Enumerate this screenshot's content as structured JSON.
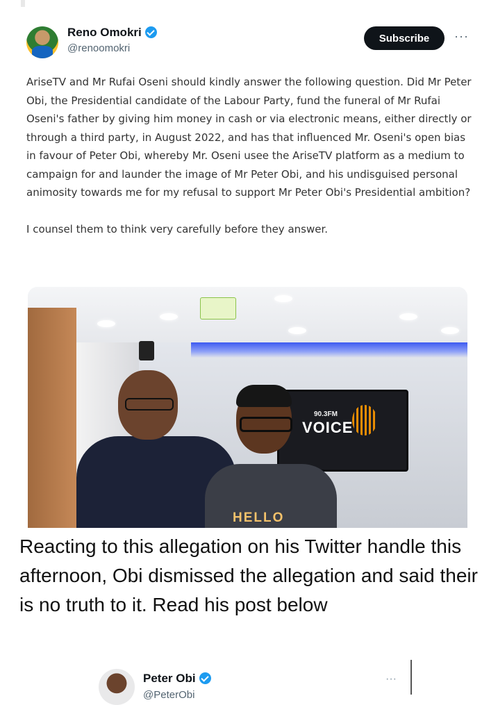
{
  "post": {
    "author_name": "Reno Omokri",
    "author_handle": "@renoomokri",
    "subscribe_label": "Subscribe",
    "more_label": "···",
    "paragraphs": [
      "AriseTV and Mr Rufai Oseni should kindly answer the following question. Did Mr Peter Obi, the Presidential candidate of the Labour Party, fund the funeral of Mr Rufai Oseni's father by giving him money in cash or via electronic means, either directly or through a third party, in August 2022, and has that influenced Mr. Oseni's open bias in favour of Peter Obi, whereby Mr. Oseni usee the AriseTV platform as a medium to campaign for and launder the image of Mr Peter Obi, and his undisguised personal animosity towards me for my refusal to support Mr Peter Obi's Presidential ambition?",
      "I counsel them to think very carefully before they answer."
    ],
    "photo": {
      "tv_frequency": "90.3FM",
      "tv_brand": "VOICE",
      "shirt_text": "HELLO"
    }
  },
  "caption": "Reacting to this allegation on his Twitter handle this afternoon, Obi dismissed the allegation and said their is no truth to it. Read his post below",
  "post2": {
    "author_name": "Peter Obi",
    "author_handle": "@PeterObi",
    "more_label": "···"
  },
  "colors": {
    "verified": "#1d9bf0",
    "subscribe_bg": "#0f1419",
    "studio_blue": "#3d5af1"
  }
}
